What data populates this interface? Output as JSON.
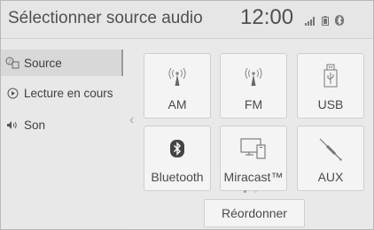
{
  "header": {
    "title": "Sélectionner source audio",
    "clock": "12:00",
    "status_icons": [
      "signal-icon",
      "phone-battery-icon",
      "bluetooth-icon"
    ]
  },
  "sidebar": {
    "items": [
      {
        "label": "Source",
        "icon": "source-icon",
        "active": true
      },
      {
        "label": "Lecture en cours",
        "icon": "play-icon",
        "active": false
      },
      {
        "label": "Son",
        "icon": "speaker-icon",
        "active": false
      }
    ]
  },
  "sources": [
    {
      "label": "AM",
      "icon": "radio-antenna-icon"
    },
    {
      "label": "FM",
      "icon": "radio-antenna-icon"
    },
    {
      "label": "USB",
      "icon": "usb-icon"
    },
    {
      "label": "Bluetooth",
      "icon": "bluetooth-icon"
    },
    {
      "label": "Miracast™",
      "icon": "miracast-icon"
    },
    {
      "label": "AUX",
      "icon": "aux-cable-icon"
    }
  ],
  "pager": {
    "total": 2,
    "current": 1
  },
  "reorder_label": "Réordonner",
  "colors": {
    "background": "#e9e9e9",
    "tile": "#f4f4f4",
    "text": "#4a4a4a"
  }
}
